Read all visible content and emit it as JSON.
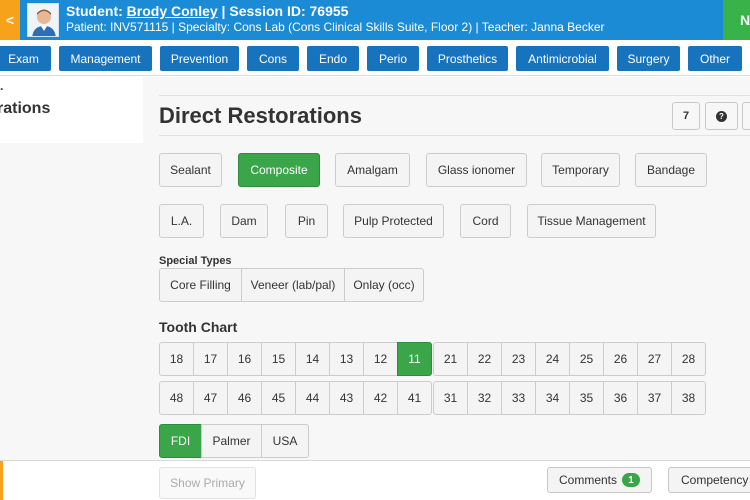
{
  "header": {
    "back_icon": "<",
    "student_prefix": "Student: ",
    "student_name": "Brody Conley",
    "session_text": " | Session ID: 76955",
    "info_line": "Patient: INV571115 | Specialty: Cons Lab (Cons Clinical Skills Suite, Floor 2) | Teacher: Janna Becker",
    "next_label": "N",
    "colors": {
      "bar": "#1b8bd6",
      "back": "#f6a21b",
      "next": "#37b34a"
    }
  },
  "nav": {
    "tabs": [
      "Exam",
      "Management",
      "Prevention",
      "Cons",
      "Endo",
      "Perio",
      "Prosthetics",
      "Antimicrobial",
      "Surgery",
      "Other"
    ],
    "color": "#1873bf"
  },
  "sidebar": {
    "dot": "·",
    "title": "rations"
  },
  "main": {
    "title": "Direct Restorations",
    "tool_count": "7",
    "help_icon": "?",
    "restoration_types": [
      "Sealant",
      "Composite",
      "Amalgam",
      "Glass ionomer",
      "Temporary",
      "Bandage"
    ],
    "restoration_selected": "Composite",
    "extras": [
      "L.A.",
      "Dam",
      "Pin",
      "Pulp Protected",
      "Cord",
      "Tissue Management"
    ],
    "special_label": "Special Types",
    "special_types": [
      "Core Filling",
      "Veneer (lab/pal)",
      "Onlay (occ)"
    ],
    "tooth_chart_title": "Tooth Chart",
    "teeth_upper_right": [
      "18",
      "17",
      "16",
      "15",
      "14",
      "13",
      "12",
      "11"
    ],
    "teeth_upper_left": [
      "21",
      "22",
      "23",
      "24",
      "25",
      "26",
      "27",
      "28"
    ],
    "teeth_lower_right": [
      "48",
      "47",
      "46",
      "45",
      "44",
      "43",
      "42",
      "41"
    ],
    "teeth_lower_left": [
      "31",
      "32",
      "33",
      "34",
      "35",
      "36",
      "37",
      "38"
    ],
    "tooth_selected": "11",
    "notation": [
      "FDI",
      "Palmer",
      "USA"
    ],
    "notation_selected": "FDI",
    "accent": "#3aa549"
  },
  "bottom": {
    "show_primary": "Show Primary",
    "comments": "Comments",
    "comments_count": "1",
    "competency": "Competency"
  }
}
